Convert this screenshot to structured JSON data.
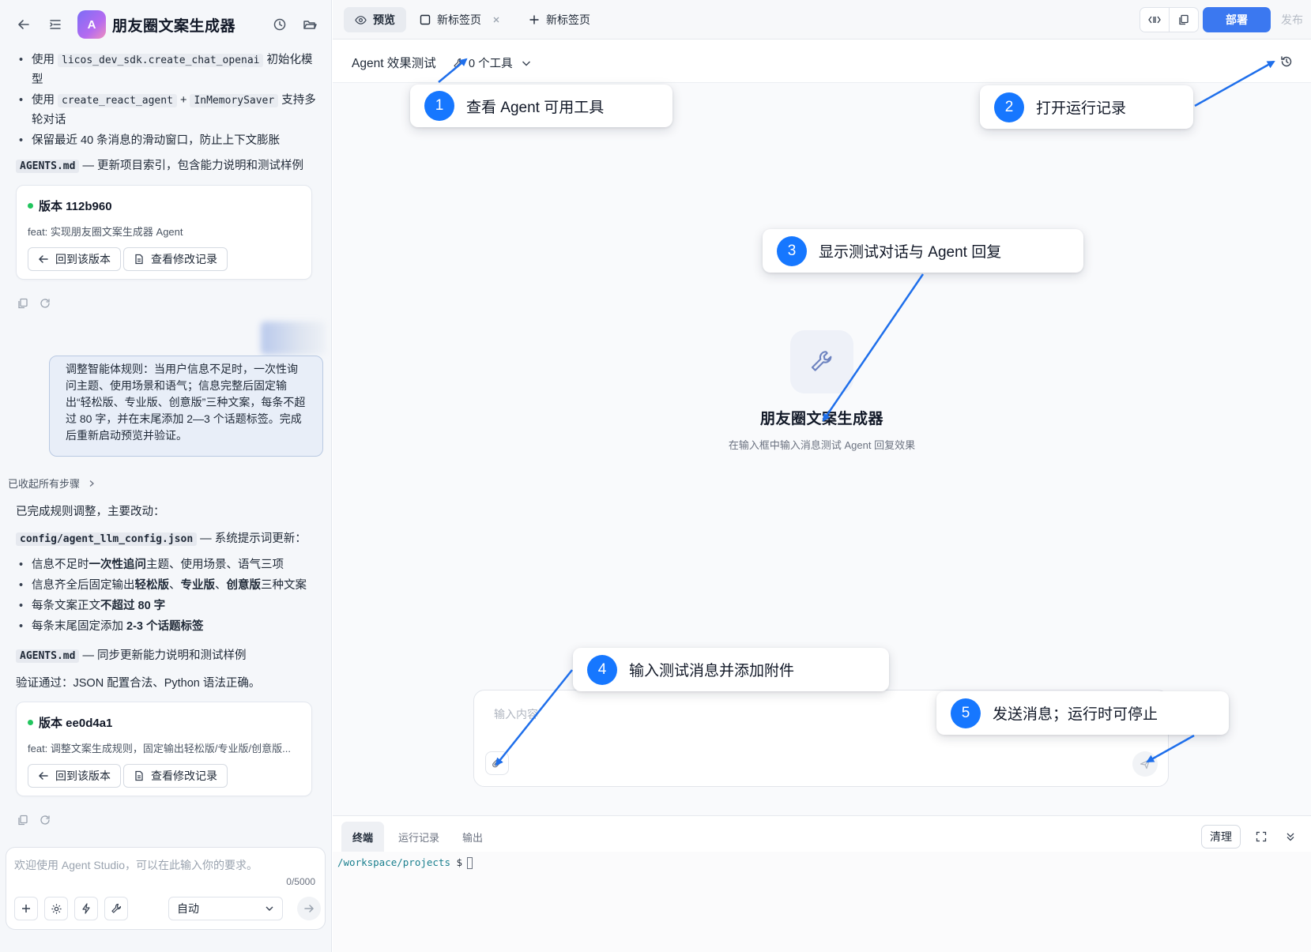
{
  "left": {
    "app_avatar_letter": "A",
    "app_title": "朋友圈文案生成器",
    "bullets_top": [
      {
        "pre": "使用 ",
        "code": "licos_dev_sdk.create_chat_openai",
        "post": " 初始化模型"
      },
      {
        "pre": "使用 ",
        "code": "create_react_agent",
        "mid": " + ",
        "code2": "InMemorySaver",
        "post": " 支持多轮对话"
      },
      {
        "text": "保留最近 40 条消息的滑动窗口，防止上下文膨胀"
      }
    ],
    "agents_line_1": {
      "code": "AGENTS.md",
      "text": " — 更新项目索引，包含能力说明和测试样例"
    },
    "version_card_1": {
      "title": "版本 112b960",
      "subtitle": "feat: 实现朋友圈文案生成器 Agent",
      "revert_label": "回到该版本",
      "history_label": "查看修改记录"
    },
    "user_message": "调整智能体规则：当用户信息不足时，一次性询问主题、使用场景和语气；信息完整后固定输出“轻松版、专业版、创意版”三种文案，每条不超过 80 字，并在末尾添加 2—3 个话题标签。完成后重新启动预览并验证。",
    "collapsed_label": "已收起所有步骤",
    "done_intro": "已完成规则调整，主要改动：",
    "config_line": {
      "code": "config/agent_llm_config.json",
      "text": " — 系统提示词更新："
    },
    "bullets_bottom": [
      {
        "pre": "信息不足时",
        "bold": "一次性追问",
        "post": "主题、使用场景、语气三项"
      },
      {
        "pre": "信息齐全后固定输出",
        "bold": "轻松版",
        "mid": "、",
        "bold2": "专业版",
        "mid2": "、",
        "bold3": "创意版",
        "post": "三种文案"
      },
      {
        "pre": "每条文案正文",
        "bold": "不超过 80 字",
        "post": ""
      },
      {
        "pre": "每条末尾固定添加 ",
        "bold": "2-3 个话题标签",
        "post": ""
      }
    ],
    "agents_line_2": {
      "code": "AGENTS.md",
      "text": " — 同步更新能力说明和测试样例"
    },
    "verify_line": "验证通过：JSON 配置合法、Python 语法正确。",
    "version_card_2": {
      "title": "版本 ee0d4a1",
      "subtitle": "feat: 调整文案生成规则，固定输出轻松版/专业版/创意版...",
      "revert_label": "回到该版本",
      "history_label": "查看修改记录"
    },
    "input": {
      "placeholder": "欢迎使用 Agent Studio，可以在此输入你的要求。",
      "count": "0/5000",
      "mode": "自动"
    }
  },
  "topbar": {
    "tabs": [
      {
        "label": "预览",
        "icon": "eye-icon"
      },
      {
        "label": "新标签页",
        "icon": "square-icon"
      },
      {
        "label": "新标签页",
        "icon": "plus-icon"
      }
    ],
    "deploy_label": "部署",
    "publish_label": "发布"
  },
  "subbar": {
    "title": "Agent 效果测试",
    "tools_label": "0 个工具"
  },
  "preview": {
    "agent_name": "朋友圈文案生成器",
    "hint": "在输入框中输入消息测试 Agent 回复效果",
    "input_placeholder": "输入内容"
  },
  "terminal": {
    "tabs": [
      "终端",
      "运行记录",
      "输出"
    ],
    "clear_label": "清理",
    "path": "/workspace/projects",
    "prompt_symbol": "$"
  },
  "callouts": [
    {
      "num": "1",
      "text": "查看 Agent 可用工具"
    },
    {
      "num": "2",
      "text": "打开运行记录"
    },
    {
      "num": "3",
      "text": "显示测试对话与 Agent 回复"
    },
    {
      "num": "4",
      "text": "输入测试消息并添加附件"
    },
    {
      "num": "5",
      "text": "发送消息；运行时可停止"
    }
  ],
  "colors": {
    "accent": "#1677ff",
    "deploy": "#3b78f0",
    "status_green": "#22c55e",
    "arrow": "#1f6feb"
  }
}
